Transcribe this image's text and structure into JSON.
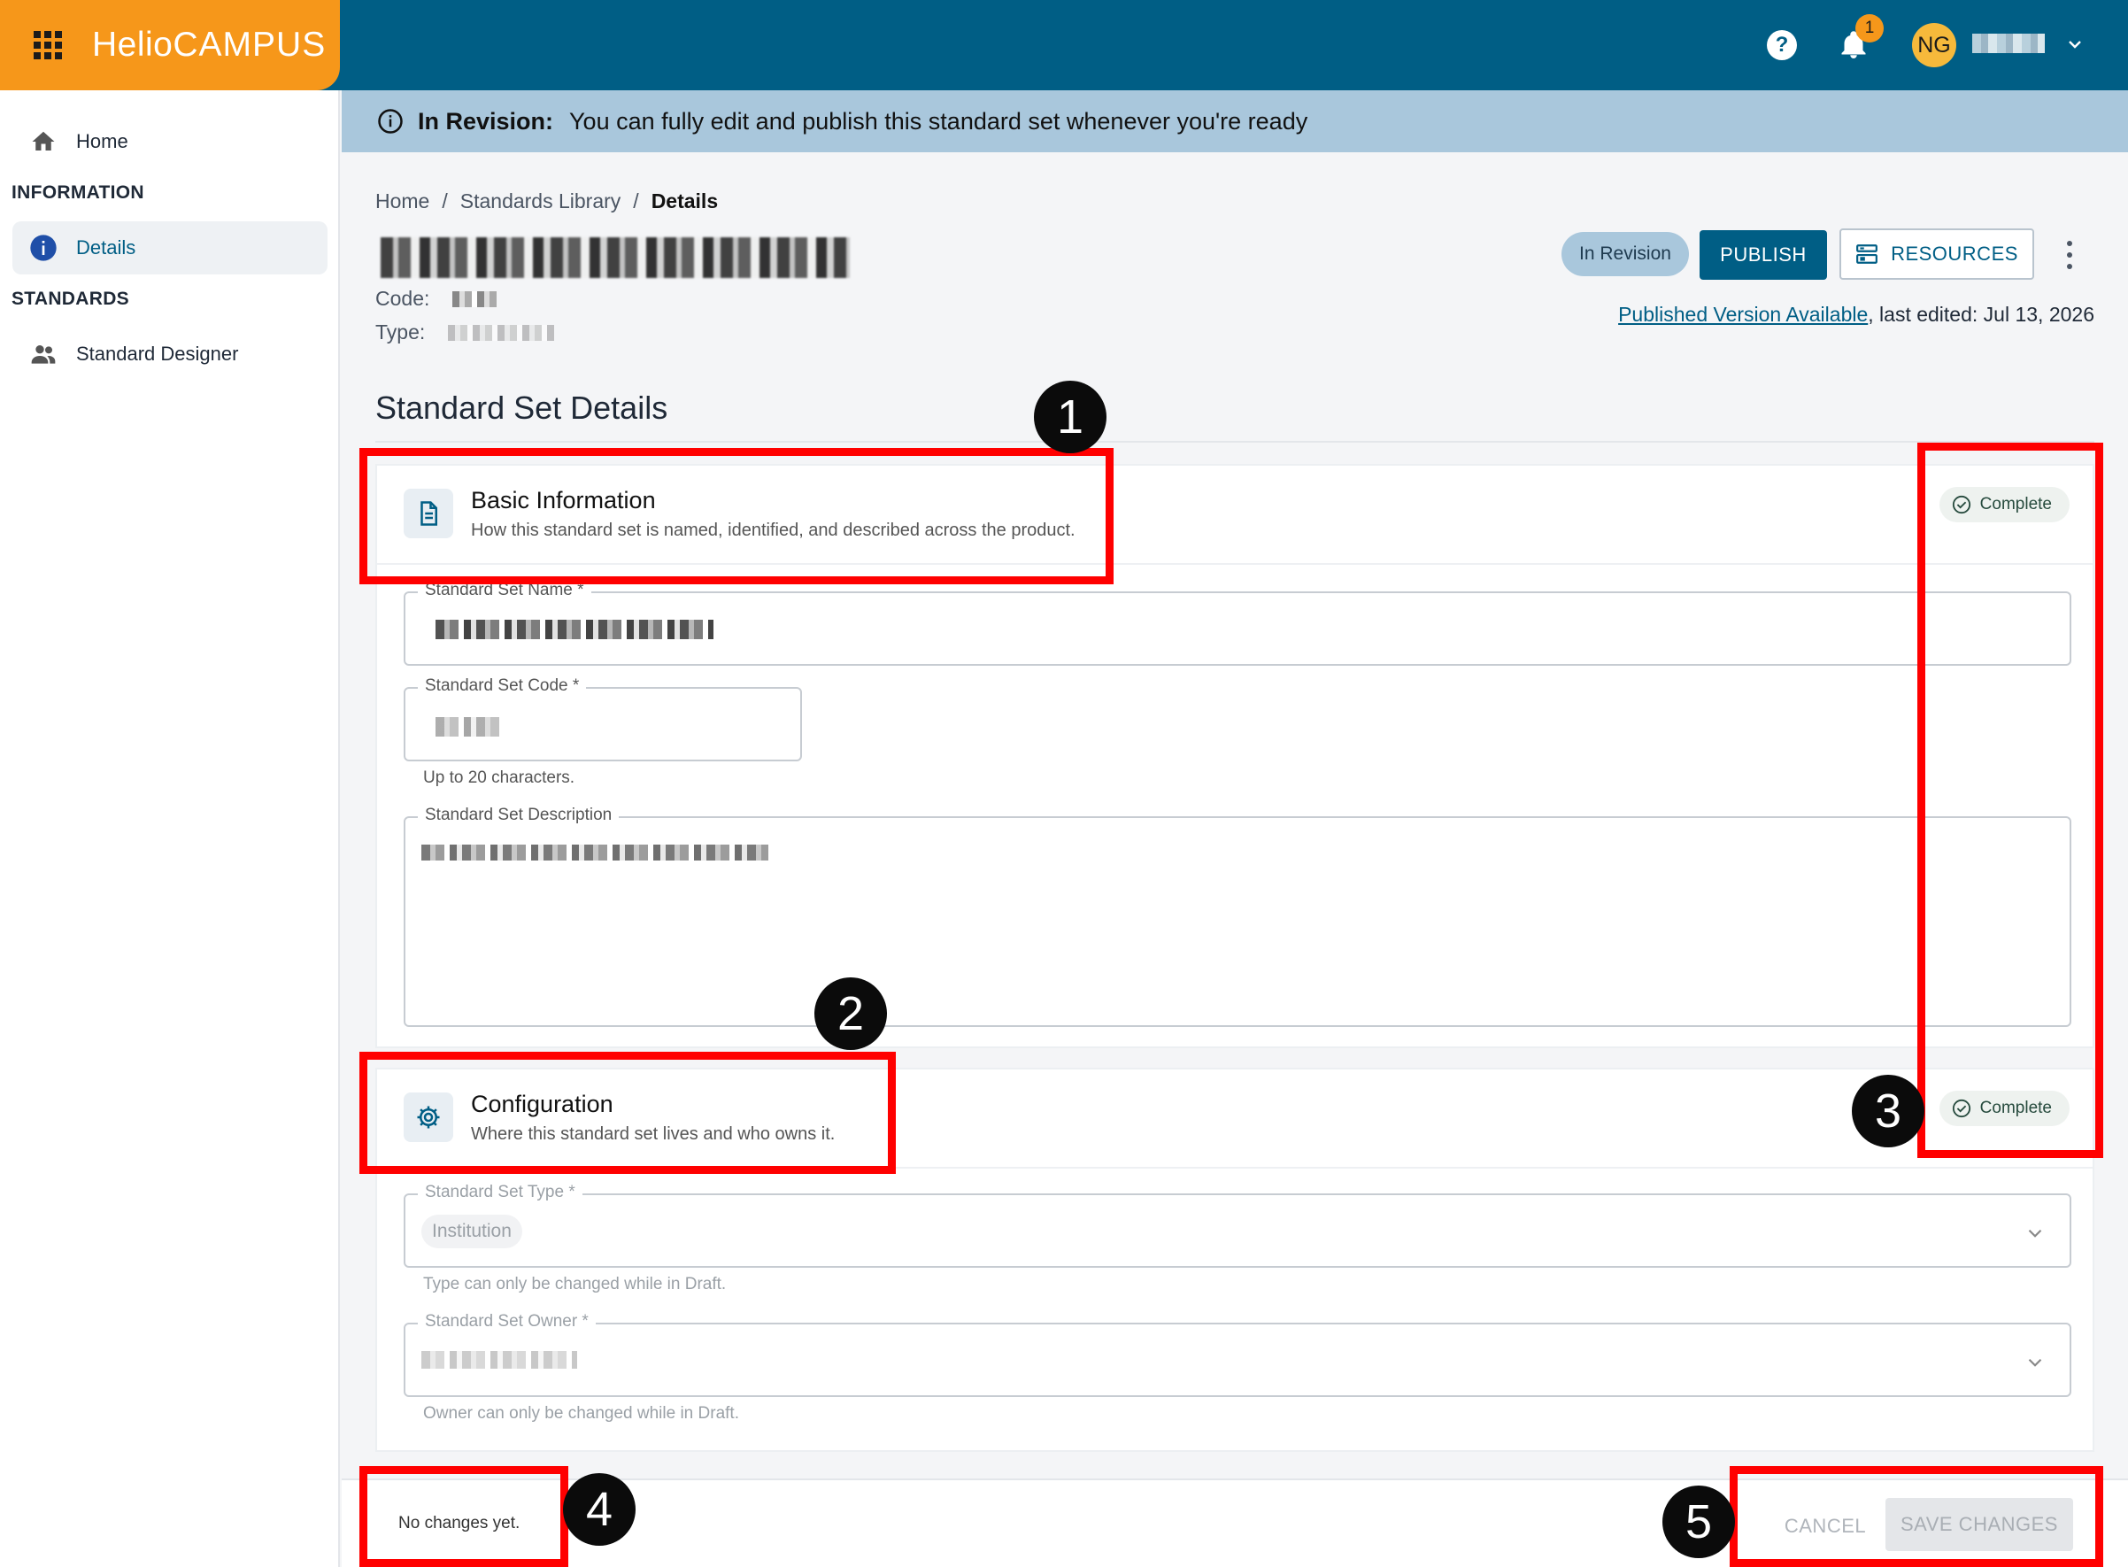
{
  "brand": {
    "logo_part1": "Helio",
    "logo_part2": "CAMPUS"
  },
  "topbar": {
    "help_icon": "?",
    "notification_count": "1",
    "avatar_initials": "NG"
  },
  "sidebar": {
    "home_label": "Home",
    "section_information": "INFORMATION",
    "details_label": "Details",
    "section_standards": "STANDARDS",
    "designer_label": "Standard Designer"
  },
  "banner": {
    "title": "In Revision:",
    "text": "You can fully edit and publish this standard set whenever you're ready"
  },
  "breadcrumb": {
    "home": "Home",
    "sep1": "/",
    "library": "Standards Library",
    "sep2": "/",
    "current": "Details"
  },
  "header": {
    "code_label": "Code:",
    "type_label": "Type:",
    "status_pill": "In Revision",
    "publish_label": "PUBLISH",
    "resources_label": "RESOURCES",
    "published_link": "Published Version Available",
    "last_edited": ", last edited: Jul 13, 2026"
  },
  "main": {
    "section_title": "Standard Set Details"
  },
  "basic_info": {
    "title": "Basic Information",
    "subtitle": "How this standard set is named, identified, and described across the product.",
    "status": "Complete",
    "name_label": "Standard Set Name *",
    "code_label": "Standard Set Code *",
    "code_helper": "Up to 20 characters.",
    "description_label": "Standard Set Description"
  },
  "configuration": {
    "title": "Configuration",
    "subtitle": "Where this standard set lives and who owns it.",
    "status": "Complete",
    "type_label": "Standard Set Type *",
    "type_value": "Institution",
    "type_helper": "Type can only be changed while in Draft.",
    "owner_label": "Standard Set Owner *",
    "owner_helper": "Owner can only be changed while in Draft."
  },
  "footer": {
    "status": "No changes yet.",
    "cancel_label": "CANCEL",
    "save_label": "SAVE CHANGES"
  },
  "annotations": [
    "1",
    "2",
    "3",
    "4",
    "5"
  ],
  "colors": {
    "brand_orange": "#f6971a",
    "primary_blue": "#005e85",
    "banner_blue": "#a9c7dc",
    "annotation_red": "#ff0000"
  }
}
